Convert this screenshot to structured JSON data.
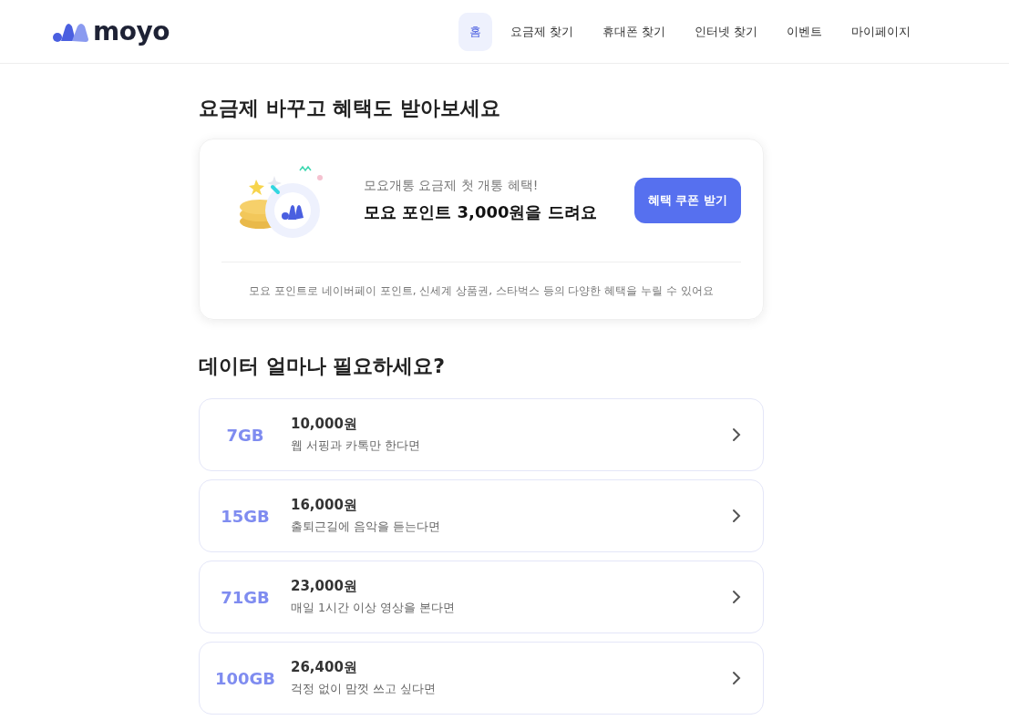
{
  "header": {
    "logo": "moyo",
    "nav": [
      {
        "label": "홈",
        "selected": true
      },
      {
        "label": "요금제 찾기",
        "selected": false
      },
      {
        "label": "휴대폰 찾기",
        "selected": false
      },
      {
        "label": "인터넷 찾기",
        "selected": false
      },
      {
        "label": "이벤트",
        "selected": false
      },
      {
        "label": "마이페이지",
        "selected": false
      }
    ]
  },
  "promo": {
    "heading": "요금제 바꾸고 혜택도 받아보세요",
    "subtitle": "모요개통 요금제 첫 개통 혜택!",
    "title": "모요 포인트 3,000원을 드려요",
    "button": "혜택 쿠폰 받기",
    "note": "모요 포인트로 네이버페이 포인트, 신세계 상품권, 스타벅스 등의 다양한 혜택을 누릴 수 있어요"
  },
  "data_section": {
    "heading": "데이터 얼마나 필요하세요?",
    "plans": [
      {
        "data": "7GB",
        "price": "10,000원",
        "description": "웹 서핑과 카톡만 한다면"
      },
      {
        "data": "15GB",
        "price": "16,000원",
        "description": "출퇴근길에 음악을 듣는다면"
      },
      {
        "data": "71GB",
        "price": "23,000원",
        "description": "매일 1시간 이상 영상을 본다면"
      },
      {
        "data": "100GB",
        "price": "26,400원",
        "description": "걱정 없이 맘껏 쓰고 싶다면"
      }
    ]
  }
}
